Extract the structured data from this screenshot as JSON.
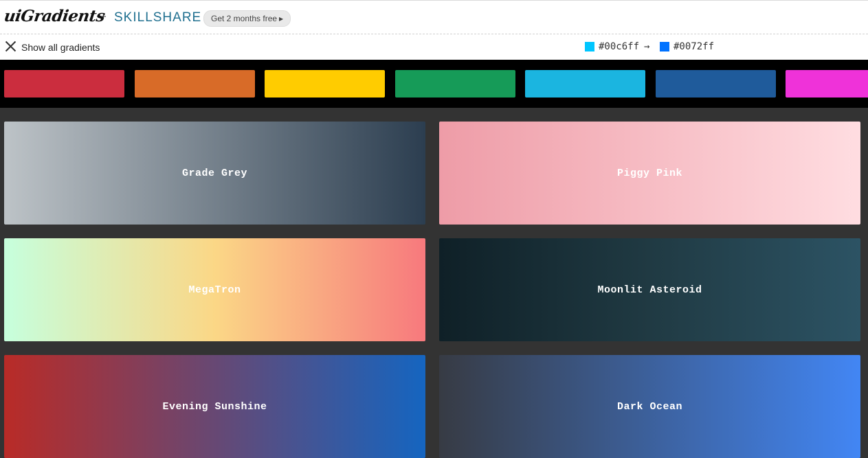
{
  "header": {
    "logo": "uiGradients",
    "plus": "+",
    "partner": "SKILLSHARE",
    "promo_label": "Get 2 months free",
    "promo_arrow_icon": "triangle-right-icon"
  },
  "subbar": {
    "close_icon": "close-icon",
    "show_all_label": "Show all gradients",
    "current_gradient": {
      "from_hex": "#00c6ff",
      "to_hex": "#0072ff",
      "arrow": "→"
    }
  },
  "palette": [
    "#cb2d3e",
    "#d86b28",
    "#ffcc00",
    "#169b58",
    "#1bb5e0",
    "#1f5b9b",
    "#ef32d9"
  ],
  "gradients": [
    {
      "name": "Grade Grey",
      "from": "#bdc3c7",
      "to": "#2c3e50"
    },
    {
      "name": "Piggy Pink",
      "from": "#ee9ca7",
      "to": "#ffdde1"
    },
    {
      "name": "MegaTron",
      "from": "#c6ffdd",
      "via": "#fbd786",
      "to": "#f7797d"
    },
    {
      "name": "Moonlit Asteroid",
      "from": "#0f2027",
      "via": "#203a43",
      "to": "#2c5364"
    },
    {
      "name": "Evening Sunshine",
      "from": "#b92b27",
      "to": "#1565c0"
    },
    {
      "name": "Dark Ocean",
      "from": "#373b44",
      "to": "#4286f4"
    }
  ]
}
